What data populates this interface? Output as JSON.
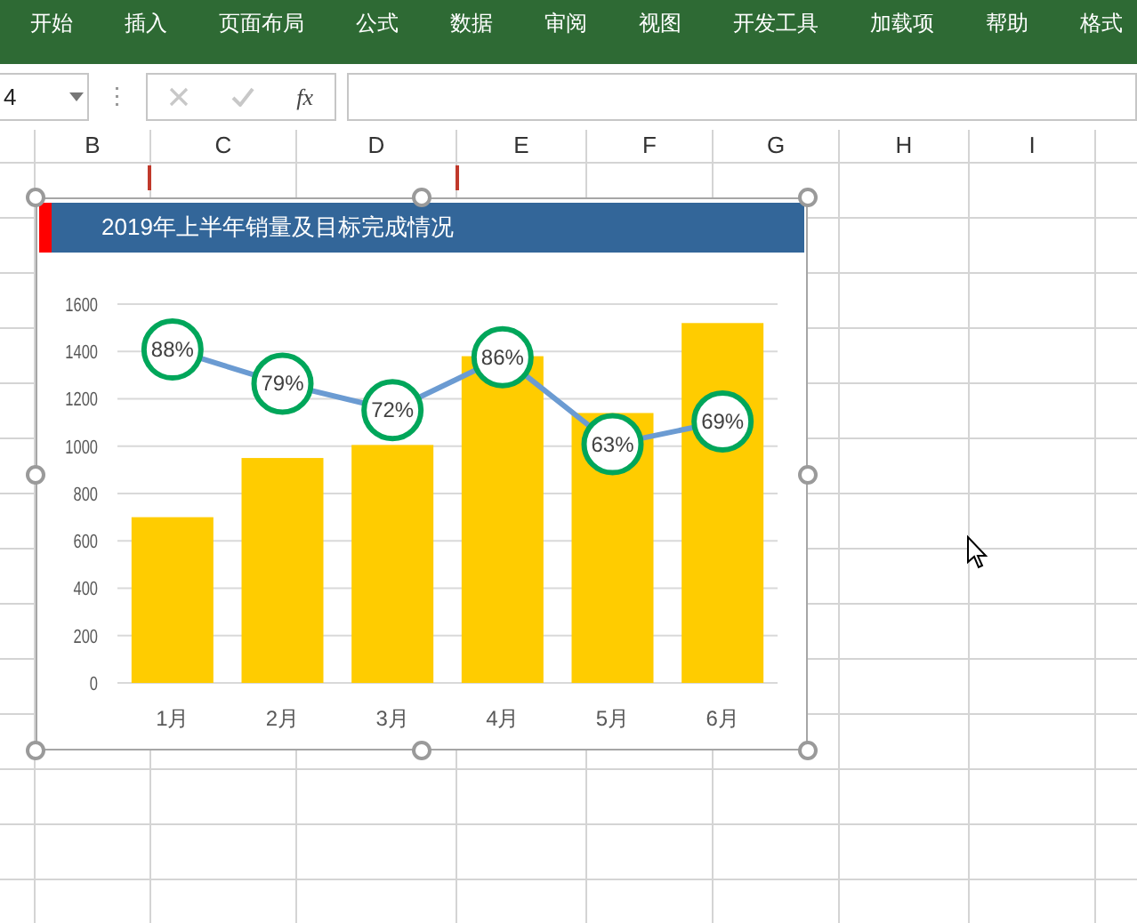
{
  "ribbon": {
    "tabs": [
      {
        "label": "开始",
        "selected": false
      },
      {
        "label": "插入",
        "selected": false
      },
      {
        "label": "页面布局",
        "selected": false
      },
      {
        "label": "公式",
        "selected": false
      },
      {
        "label": "数据",
        "selected": false
      },
      {
        "label": "审阅",
        "selected": false
      },
      {
        "label": "视图",
        "selected": false
      },
      {
        "label": "开发工具",
        "selected": false
      },
      {
        "label": "加载项",
        "selected": false
      },
      {
        "label": "帮助",
        "selected": false
      },
      {
        "label": "格式",
        "selected": false
      }
    ]
  },
  "formula_bar": {
    "name_box": "4",
    "fx": "fx"
  },
  "columns": [
    "B",
    "C",
    "D",
    "E",
    "F",
    "G",
    "H",
    "I"
  ],
  "chart": {
    "title": "2019年上半年销量及目标完成情况",
    "chart_data": {
      "type": "bar",
      "grid": true,
      "categories": [
        "1月",
        "2月",
        "3月",
        "4月",
        "5月",
        "6月"
      ],
      "ylim": [
        0,
        1600
      ],
      "yticks": [
        0,
        200,
        400,
        600,
        800,
        1000,
        1200,
        1400,
        1600
      ],
      "series": [
        {
          "color": "#ffcc00",
          "values": [
            700,
            950,
            1005,
            1380,
            1140,
            1520
          ]
        }
      ]
    },
    "rate_line": {
      "color": "#6b9bd2",
      "labels": [
        "88%",
        "79%",
        "72%",
        "86%",
        "63%",
        "69%"
      ]
    }
  }
}
